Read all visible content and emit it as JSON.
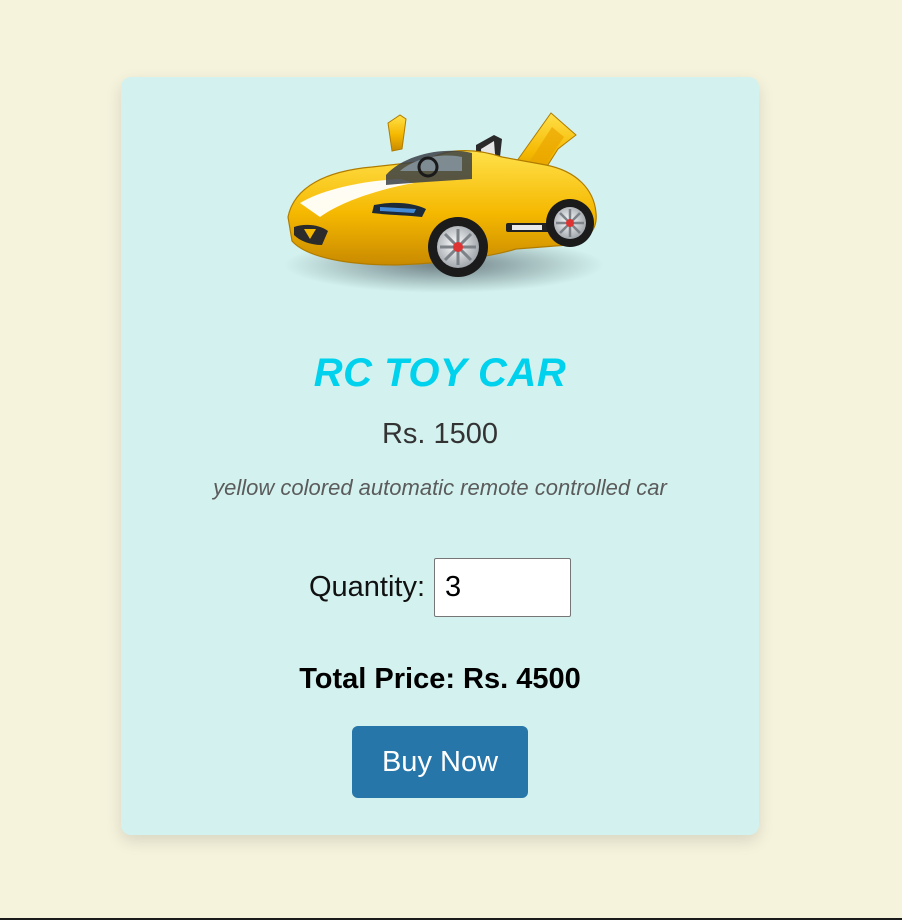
{
  "product": {
    "name": "RC TOY CAR",
    "price": "Rs. 1500",
    "description": "yellow colored automatic remote controlled car",
    "image_icon": "yellow-toy-car-image"
  },
  "quantity": {
    "label": "Quantity:",
    "value": "3"
  },
  "total": {
    "text": "Total Price: Rs. 4500"
  },
  "actions": {
    "buy_label": "Buy Now"
  },
  "colors": {
    "page_background": "#f5f3dc",
    "card_background": "#d3f2ef",
    "title": "#00d2ee",
    "button": "#2776a9"
  }
}
